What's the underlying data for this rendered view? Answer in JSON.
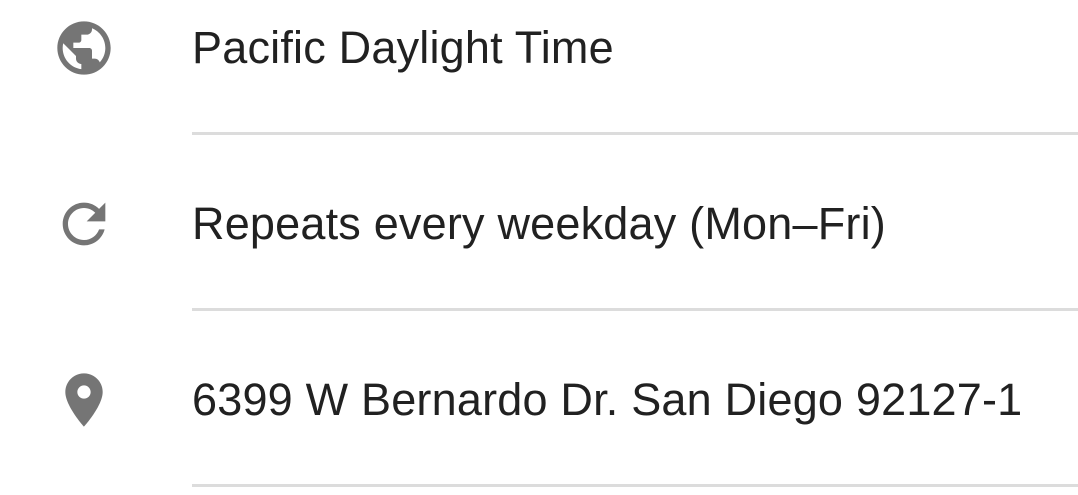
{
  "rows": [
    {
      "icon": "globe-icon",
      "text": "Pacific Daylight Time"
    },
    {
      "icon": "repeat-icon",
      "text": "Repeats every weekday (Mon–Fri)"
    },
    {
      "icon": "location-pin-icon",
      "text": "6399 W Bernardo Dr. San Diego 92127-1"
    }
  ],
  "colors": {
    "icon": "#757575",
    "text": "#212121",
    "divider": "#dcdcdc",
    "background": "#ffffff"
  }
}
